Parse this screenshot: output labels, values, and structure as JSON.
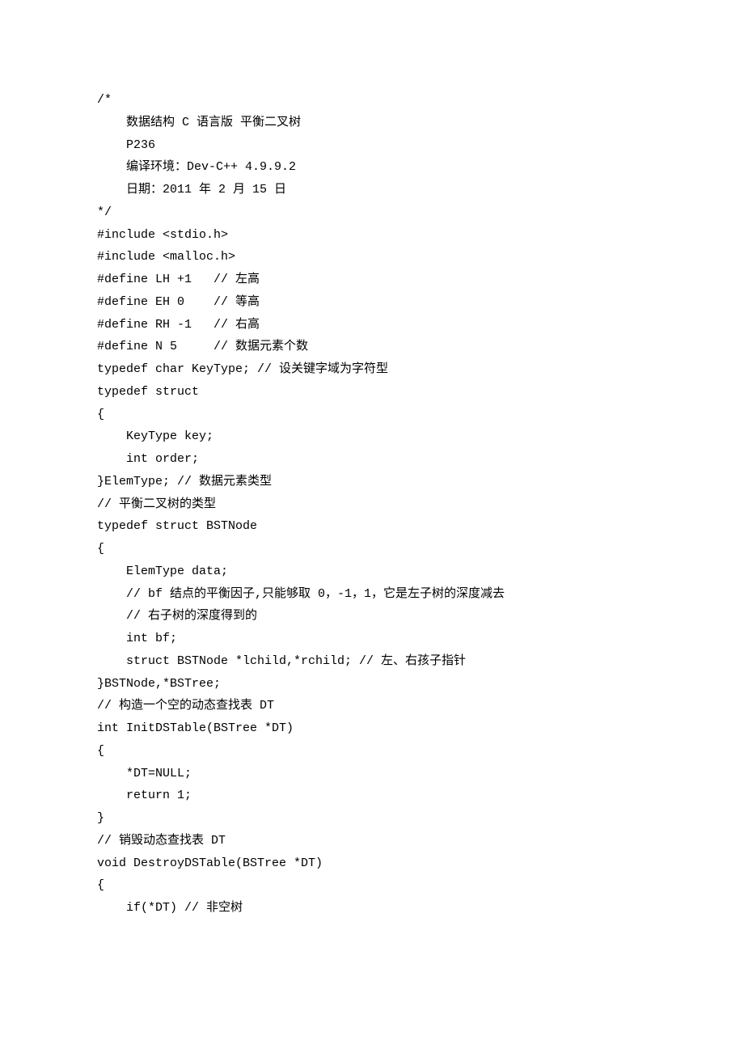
{
  "lines": [
    "/*",
    "    数据结构 C 语言版 平衡二叉树",
    "    P236",
    "    编译环境：Dev-C++ 4.9.9.2",
    "    日期：2011 年 2 月 15 日",
    "*/",
    "",
    "#include <stdio.h>",
    "#include <malloc.h>",
    "",
    "#define LH +1   // 左高",
    "#define EH 0    // 等高",
    "#define RH -1   // 右高",
    "#define N 5     // 数据元素个数",
    "",
    "typedef char KeyType; // 设关键字域为字符型",
    "",
    "typedef struct",
    "{",
    "    KeyType key;",
    "    int order;",
    "}ElemType; // 数据元素类型",
    "",
    "// 平衡二叉树的类型",
    "typedef struct BSTNode",
    "{",
    "    ElemType data;",
    "    // bf 结点的平衡因子,只能够取 0，-1，1，它是左子树的深度减去",
    "    // 右子树的深度得到的",
    "    int bf;",
    "    struct BSTNode *lchild,*rchild; // 左、右孩子指针",
    "}BSTNode,*BSTree;",
    "",
    "// 构造一个空的动态查找表 DT",
    "int InitDSTable(BSTree *DT)",
    "{",
    "    *DT=NULL;",
    "    return 1;",
    "}",
    "",
    "// 销毁动态查找表 DT",
    "void DestroyDSTable(BSTree *DT)",
    "{",
    "    if(*DT) // 非空树"
  ]
}
